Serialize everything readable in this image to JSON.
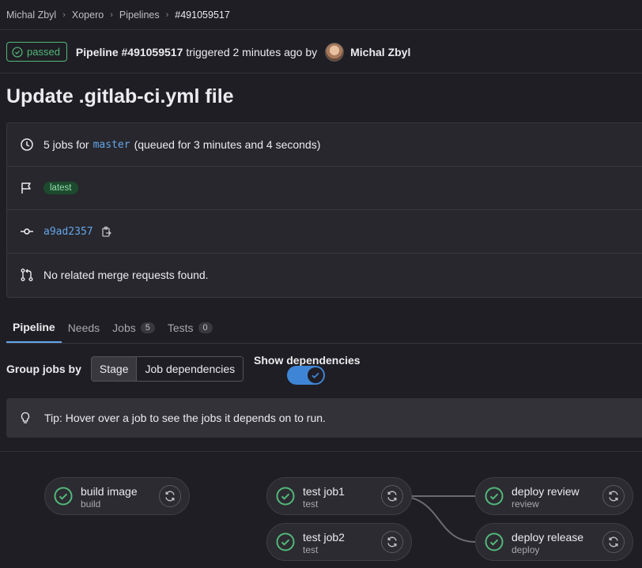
{
  "breadcrumb": [
    "Michal Zbyl",
    "Xopero",
    "Pipelines",
    "#491059517"
  ],
  "header": {
    "status": "passed",
    "pipeline": "Pipeline #491059517",
    "triggered": "triggered 2 minutes ago by",
    "user": "Michal Zbyl"
  },
  "title": "Update .gitlab-ci.yml file",
  "info": {
    "jobs_prefix": "5 jobs for",
    "branch": "master",
    "queued": "(queued for 3 minutes and 4 seconds)",
    "latest_badge": "latest",
    "commit": "a9ad2357",
    "merge_requests": "No related merge requests found."
  },
  "tabs": [
    {
      "label": "Pipeline"
    },
    {
      "label": "Needs"
    },
    {
      "label": "Jobs",
      "count": "5"
    },
    {
      "label": "Tests",
      "count": "0"
    }
  ],
  "group_by": {
    "label": "Group jobs by",
    "options": [
      "Stage",
      "Job dependencies"
    ],
    "selected": "Stage"
  },
  "show_dependencies": {
    "label": "Show dependencies",
    "on": true
  },
  "tip": "Tip: Hover over a job to see the jobs it depends on to run.",
  "jobs": [
    {
      "name": "build image",
      "stage": "build",
      "status": "success"
    },
    {
      "name": "test job1",
      "stage": "test",
      "status": "success"
    },
    {
      "name": "test job2",
      "stage": "test",
      "status": "success"
    },
    {
      "name": "deploy review",
      "stage": "review",
      "status": "success"
    },
    {
      "name": "deploy release",
      "stage": "deploy",
      "status": "success"
    }
  ],
  "colors": {
    "success": "#52b87a",
    "link": "#63a6e9",
    "toggle": "#3f85d5"
  }
}
